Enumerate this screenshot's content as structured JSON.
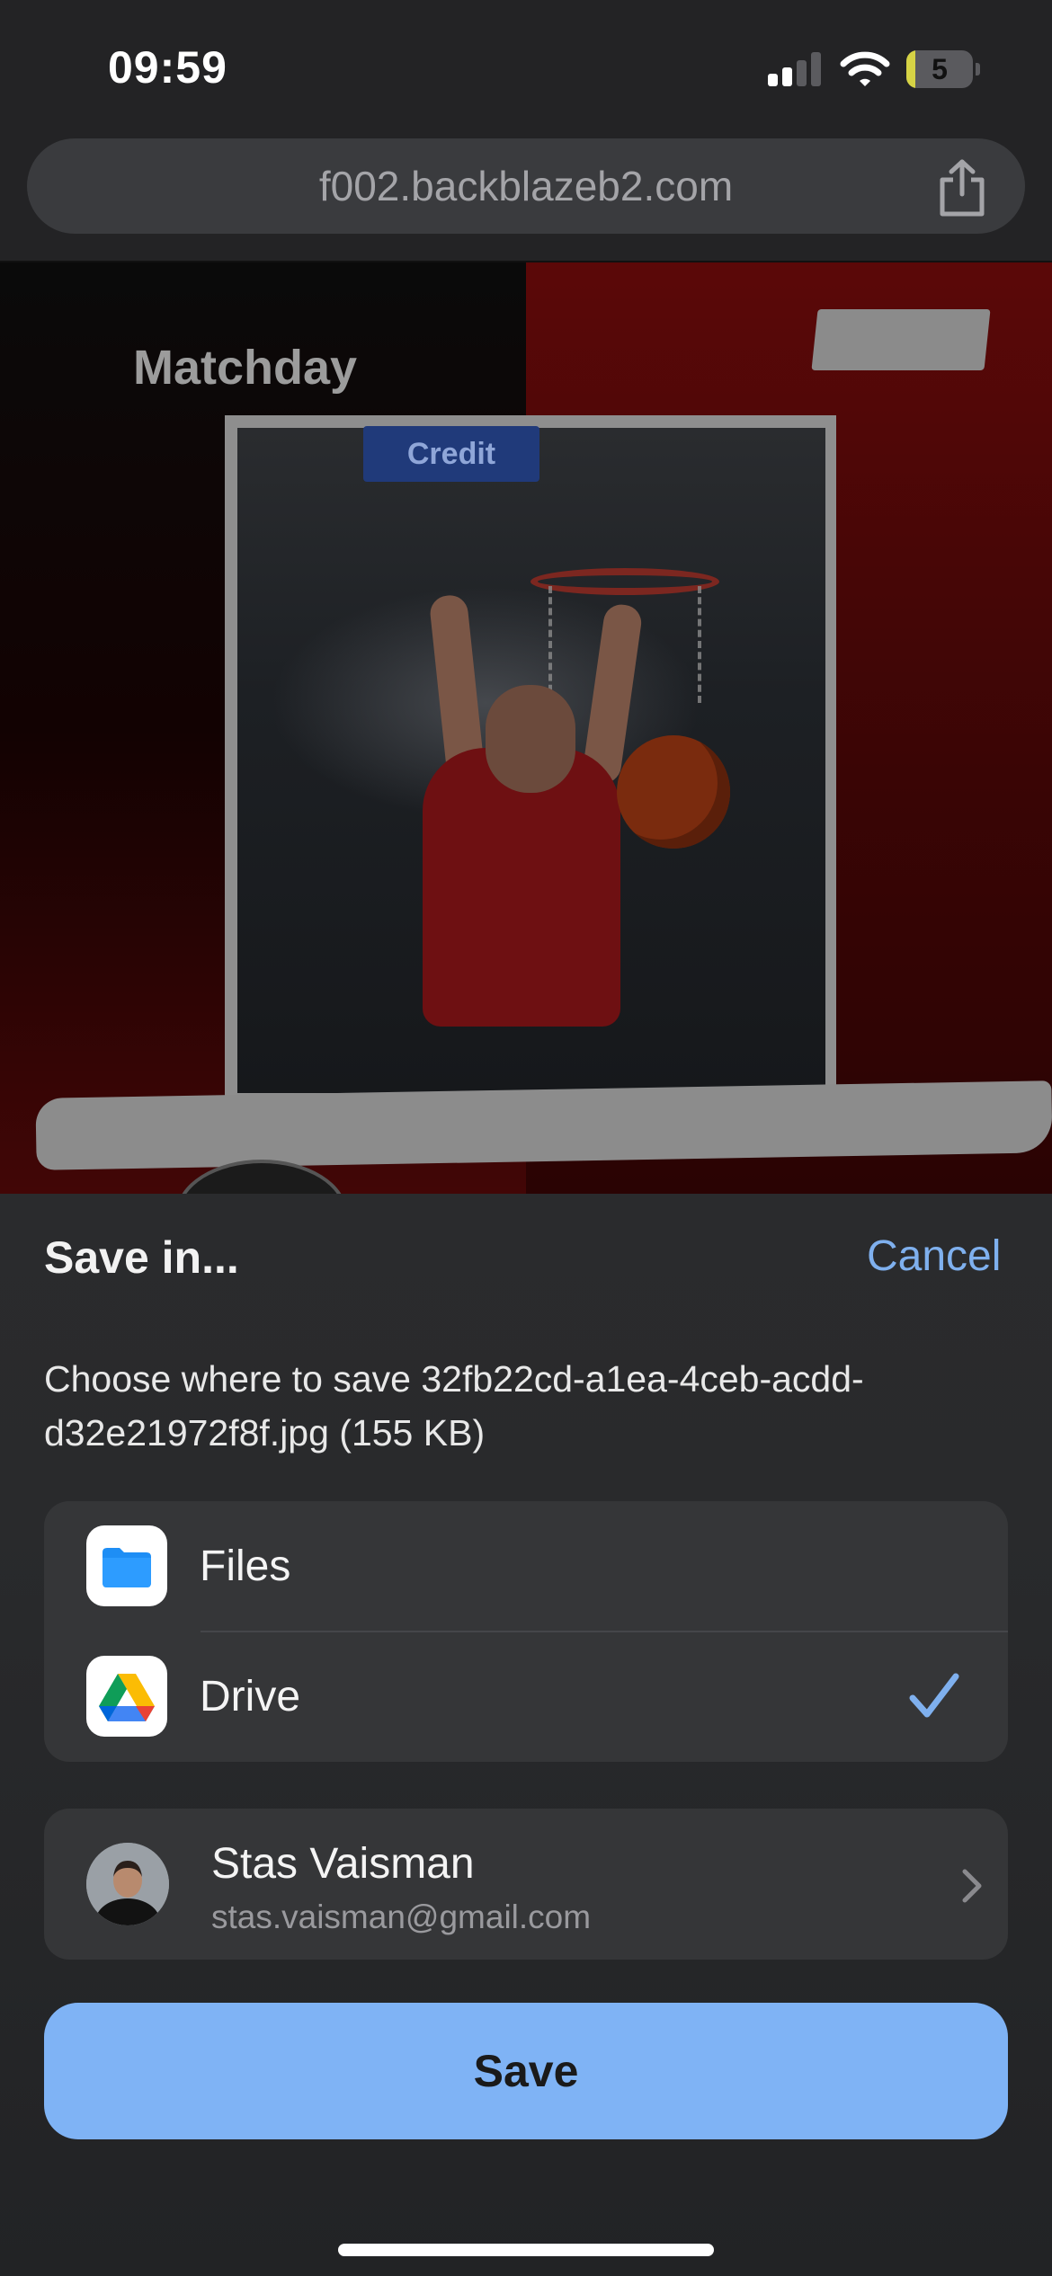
{
  "status_bar": {
    "time": "09:59",
    "battery_level": "5",
    "battery_fraction": 0.05,
    "signal_bars_active": 2,
    "signal_bars_total": 4,
    "icons": [
      "cellular-signal-icon",
      "wifi-icon",
      "battery-icon"
    ]
  },
  "browser": {
    "url": "f002.backblazeb2.com",
    "share_icon": "share-icon"
  },
  "background_image": {
    "heading": "Matchday",
    "sponsor_text": "Credit"
  },
  "sheet": {
    "title": "Save in...",
    "cancel_label": "Cancel",
    "description": "Choose where to save 32fb22cd-a1ea-4ceb-acdd-d32e21972f8f.jpg (155 KB)",
    "destinations": [
      {
        "label": "Files",
        "icon": "files-folder-icon",
        "selected": false
      },
      {
        "label": "Drive",
        "icon": "google-drive-icon",
        "selected": true
      }
    ],
    "account": {
      "name": "Stas Vaisman",
      "email": "stas.vaisman@gmail.com"
    },
    "save_label": "Save"
  },
  "colors": {
    "accent": "#7fb0ee",
    "save_button": "#7fb3f5",
    "sheet_background": "#2a2b2d",
    "group_background": "#353638"
  }
}
